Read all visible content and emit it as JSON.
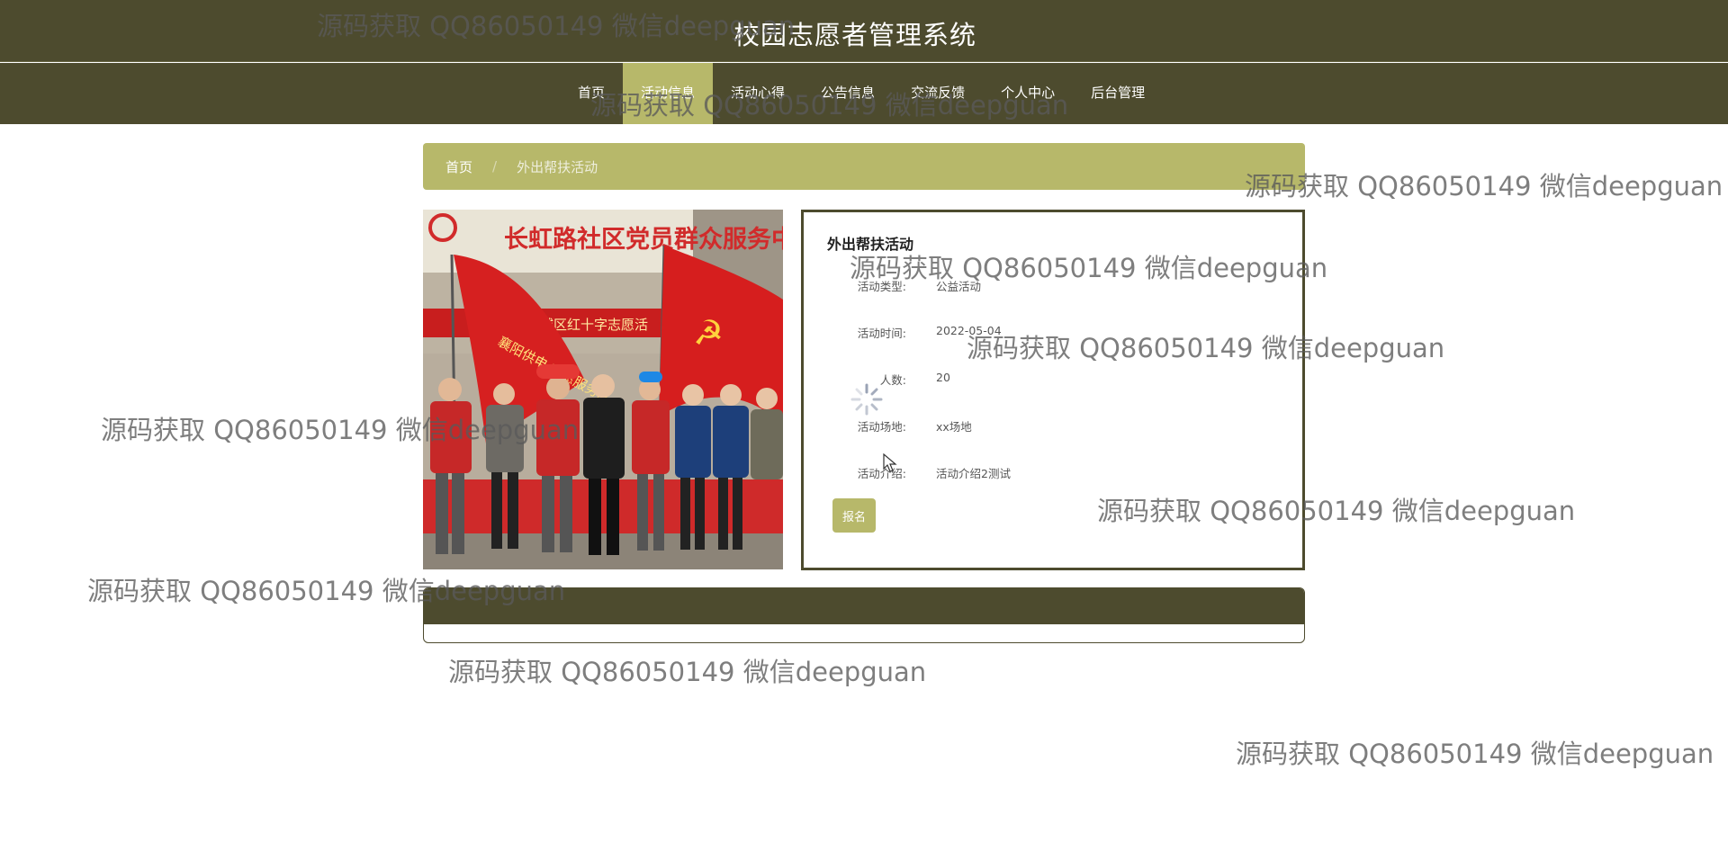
{
  "header": {
    "title": "校园志愿者管理系统"
  },
  "nav": {
    "items": [
      {
        "label": "首页"
      },
      {
        "label": "活动信息"
      },
      {
        "label": "活动心得"
      },
      {
        "label": "公告信息"
      },
      {
        "label": "交流反馈"
      },
      {
        "label": "个人中心"
      },
      {
        "label": "后台管理"
      }
    ],
    "active_index": 1
  },
  "breadcrumb": {
    "home": "首页",
    "separator": "/",
    "current": "外出帮扶活动"
  },
  "activity": {
    "title": "外出帮扶活动",
    "fields": [
      {
        "label": "活动类型:",
        "value": "公益活动"
      },
      {
        "label": "活动时间:",
        "value": "2022-05-04"
      },
      {
        "label": "人数:",
        "value": "20"
      },
      {
        "label": "活动场地:",
        "value": "xx场地"
      },
      {
        "label": "活动介绍:",
        "value": "活动介绍2测试"
      }
    ],
    "signup_label": "报名"
  },
  "photo": {
    "banner_text": "长虹路社区党员群众服务中心",
    "sub_banner_text": "城区红十字志愿活",
    "flag_text": "襄阳供电 志愿服务队"
  },
  "watermark": {
    "text": "源码获取 QQ86050149 微信deepguan"
  },
  "colors": {
    "primary": "#4d4b2e",
    "accent": "#b7b86a"
  }
}
